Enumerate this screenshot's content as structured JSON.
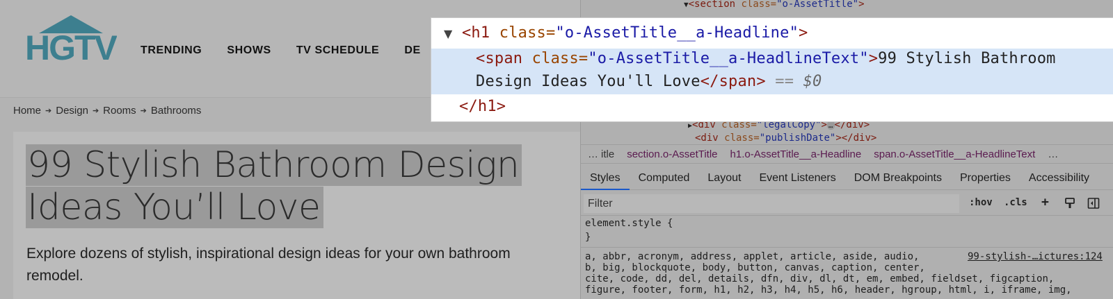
{
  "site": {
    "logo_text": "HGTV",
    "nav": [
      "TRENDING",
      "SHOWS",
      "TV SCHEDULE",
      "DE"
    ],
    "breadcrumb": [
      "Home",
      "Design",
      "Rooms",
      "Bathrooms"
    ],
    "headline_line1": "99 Stylish Bathroom Design",
    "headline_line2": "Ideas You’ll Love",
    "dek": "Explore dozens of stylish, inspirational design ideas for your own bathroom remodel."
  },
  "devtools": {
    "dom_top": {
      "section_tag": "<section",
      "section_attr": " class=",
      "section_val": "\"o-AssetTitle\"",
      "section_close": ">"
    },
    "dom_bottom": {
      "legal_tag": "<div",
      "legal_attr": " class=",
      "legal_val": "\"legalCopy\"",
      "legal_mid": ">",
      "legal_ellipsis": "…",
      "legal_close": "</div>",
      "publish_tag": "<div",
      "publish_attr": " class=",
      "publish_val": "\"publishDate\"",
      "publish_close": "></div>"
    },
    "element_breadcrumbs": [
      "…",
      "itle",
      "section.o-AssetTitle",
      "h1.o-AssetTitle__a-Headline",
      "span.o-AssetTitle__a-HeadlineText",
      "…"
    ],
    "tabs": [
      "Styles",
      "Computed",
      "Layout",
      "Event Listeners",
      "DOM Breakpoints",
      "Properties",
      "Accessibility"
    ],
    "filter_placeholder": "Filter",
    "filter_tools": {
      "hov": ":hov",
      "cls": ".cls",
      "plus": "+"
    },
    "css": {
      "element_style_open": "element.style {",
      "element_style_close": "}",
      "reset_line1": "a, abbr, acronym, address, applet, article, aside, audio,",
      "reset_line2": "b, big, blockquote, body, button, canvas, caption, center,",
      "reset_line3": "cite, code, dd, del, details, dfn, div, dl, dt, em, embed, fieldset, figcaption,",
      "reset_line4": "figure, footer, form, h1, h2, h3, h4, h5, h6, header, hgroup, html, i, iframe, img,",
      "source_link": "99-stylish-…ictures:124"
    }
  },
  "zoom": {
    "h1_open_tag": "<h1",
    "h1_attr": " class=",
    "h1_val": "\"o-AssetTitle__a-Headline\"",
    "h1_close_bracket": ">",
    "span_open_tag": "<span",
    "span_attr": " class=",
    "span_val": "\"o-AssetTitle__a-HeadlineText\"",
    "span_close_bracket": ">",
    "span_text_1": "99 Stylish Bathroom",
    "span_text_2": "Design Ideas You'll Love",
    "span_end_tag": "</span>",
    "eq_marker": " == ",
    "dollar_zero": "$0",
    "h1_end_tag": "</h1>"
  },
  "colors": {
    "logo": "#3d7f8f",
    "selection": "#d6e5f7",
    "active_tab": "#1a58c9"
  }
}
